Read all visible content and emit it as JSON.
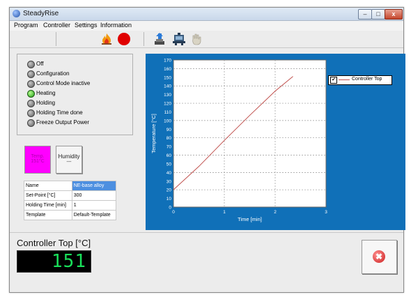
{
  "window": {
    "title": "SteadyRise",
    "controls": {
      "minimize": "–",
      "maximize": "□",
      "close": "x"
    }
  },
  "menu": [
    "Program",
    "Controller",
    "Settings",
    "Information"
  ],
  "toolbar": {
    "icons": [
      "fire-icon",
      "record-icon",
      "upload-icon",
      "robot-icon",
      "hand-icon"
    ],
    "record_color": "#e00000"
  },
  "status": {
    "items": [
      {
        "label": "Off",
        "active": false
      },
      {
        "label": "Configuration",
        "active": false
      },
      {
        "label": "Control Mode inactive",
        "active": false
      },
      {
        "label": "Heating",
        "active": true
      },
      {
        "label": "Holding",
        "active": false
      },
      {
        "label": "Holding Time done",
        "active": false
      },
      {
        "label": "Freeze Output Power",
        "active": false
      }
    ]
  },
  "tiles": {
    "temp": {
      "label": "Temp.",
      "value": "151°C"
    },
    "humidity": {
      "label": "Humidity",
      "value": "---"
    }
  },
  "info_table": [
    {
      "key": "Name",
      "value": "NE-base alloy"
    },
    {
      "key": "Set-Point [°C]",
      "value": "300"
    },
    {
      "key": "Holding Time [min]",
      "value": "1"
    },
    {
      "key": "Template",
      "value": "Default-Template"
    }
  ],
  "chart_data": {
    "type": "line",
    "xlabel": "Time [min]",
    "ylabel": "Temperature [°C]",
    "xlim": [
      0,
      3
    ],
    "ylim": [
      0,
      170
    ],
    "xticks": [
      0,
      1,
      2,
      3
    ],
    "yticks": [
      0,
      10,
      20,
      30,
      40,
      50,
      60,
      70,
      80,
      90,
      100,
      110,
      120,
      130,
      140,
      150,
      160,
      170
    ],
    "grid": true,
    "legend_position": "right",
    "series": [
      {
        "name": "Controller Top",
        "color": "#c0504d",
        "x": [
          0,
          0.5,
          1.0,
          1.5,
          2.0,
          2.35
        ],
        "y": [
          20,
          47,
          77,
          106,
          134,
          151
        ]
      }
    ]
  },
  "controller": {
    "title": "Controller Top [°C]",
    "value": "151",
    "value_color": "#19e05a"
  },
  "close_button": {
    "icon": "close-circle-icon",
    "glyph": "✖"
  }
}
